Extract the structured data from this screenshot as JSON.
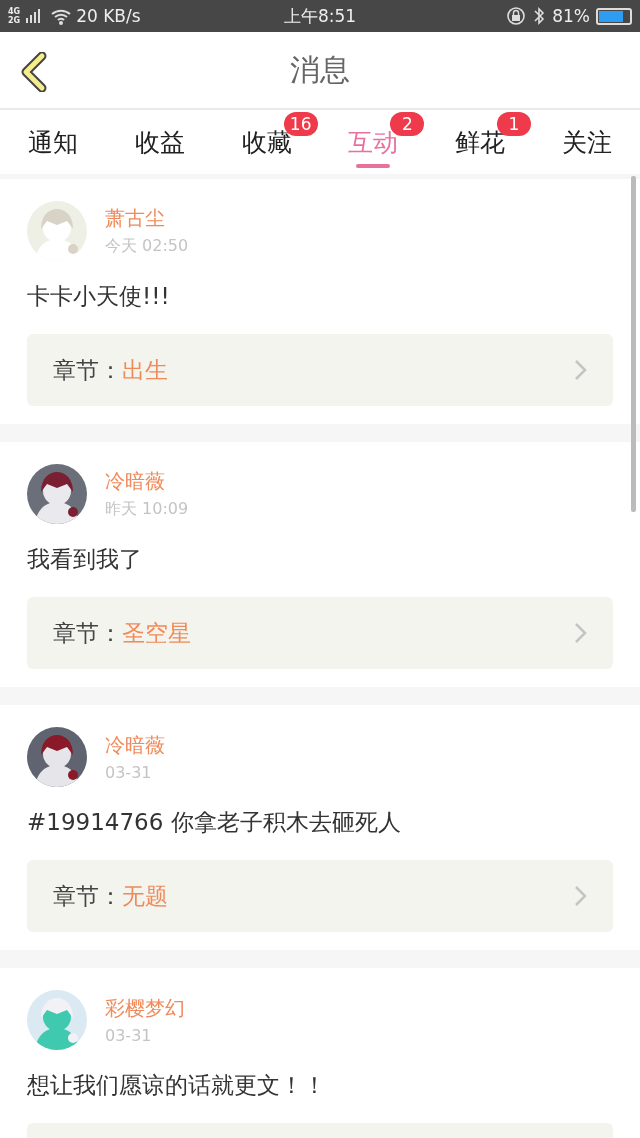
{
  "status_bar": {
    "network": [
      "4G",
      "2G"
    ],
    "speed": "20 KB/s",
    "time": "上午8:51",
    "battery": "81%"
  },
  "header": {
    "title": "消息"
  },
  "tabs": [
    {
      "label": "通知",
      "selected": false
    },
    {
      "label": "收益",
      "selected": false
    },
    {
      "label": "收藏",
      "selected": false,
      "badge": "16"
    },
    {
      "label": "互动",
      "selected": true,
      "badge": "2"
    },
    {
      "label": "鲜花",
      "selected": false,
      "badge": "1"
    },
    {
      "label": "关注",
      "selected": false
    }
  ],
  "messages": [
    {
      "user": "萧古尘",
      "time": "今天 02:50",
      "text": "卡卡小天使!!!",
      "chapter_label": "章节：",
      "chapter": "出生"
    },
    {
      "user": "冷暗薇",
      "time": "昨天 10:09",
      "text": "我看到我了",
      "chapter_label": "章节：",
      "chapter": "圣空星"
    },
    {
      "user": "冷暗薇",
      "time": "03-31",
      "text": "#19914766 你拿老子积木去砸死人",
      "chapter_label": "章节：",
      "chapter": "无题"
    },
    {
      "user": "彩樱梦幻",
      "time": "03-31",
      "text": "想让我们愿谅的话就更文！！"
    }
  ]
}
